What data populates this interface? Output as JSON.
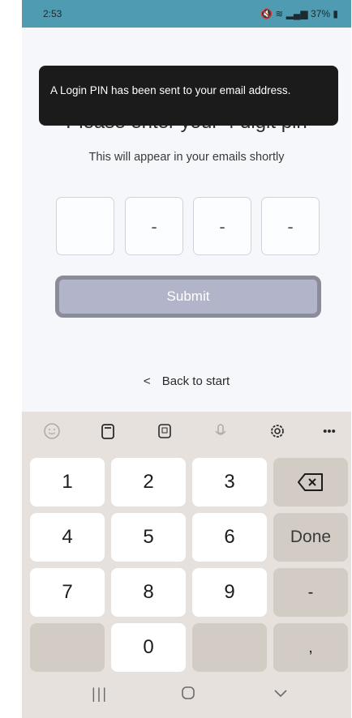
{
  "status_bar": {
    "time": "2:53",
    "battery": "37%"
  },
  "toast": {
    "message": "A Login PIN has been sent to your email address."
  },
  "page": {
    "title": "Please enter your 4 digit pin",
    "subtitle": "This will appear in your emails shortly",
    "pin": [
      "",
      "-",
      "-",
      "-"
    ],
    "submit_label": "Submit",
    "back_label": "Back to start"
  },
  "keyboard": {
    "rows": [
      [
        "1",
        "2",
        "3",
        "⌫"
      ],
      [
        "4",
        "5",
        "6",
        "Done"
      ],
      [
        "7",
        "8",
        "9",
        "-"
      ],
      [
        "",
        "0",
        "",
        ","
      ]
    ]
  },
  "icons": {
    "back": "chevron-left-icon",
    "toolbar": [
      "emoji-icon",
      "clipboard-icon",
      "keypad-icon",
      "microphone-icon",
      "settings-icon",
      "more-icon"
    ]
  }
}
